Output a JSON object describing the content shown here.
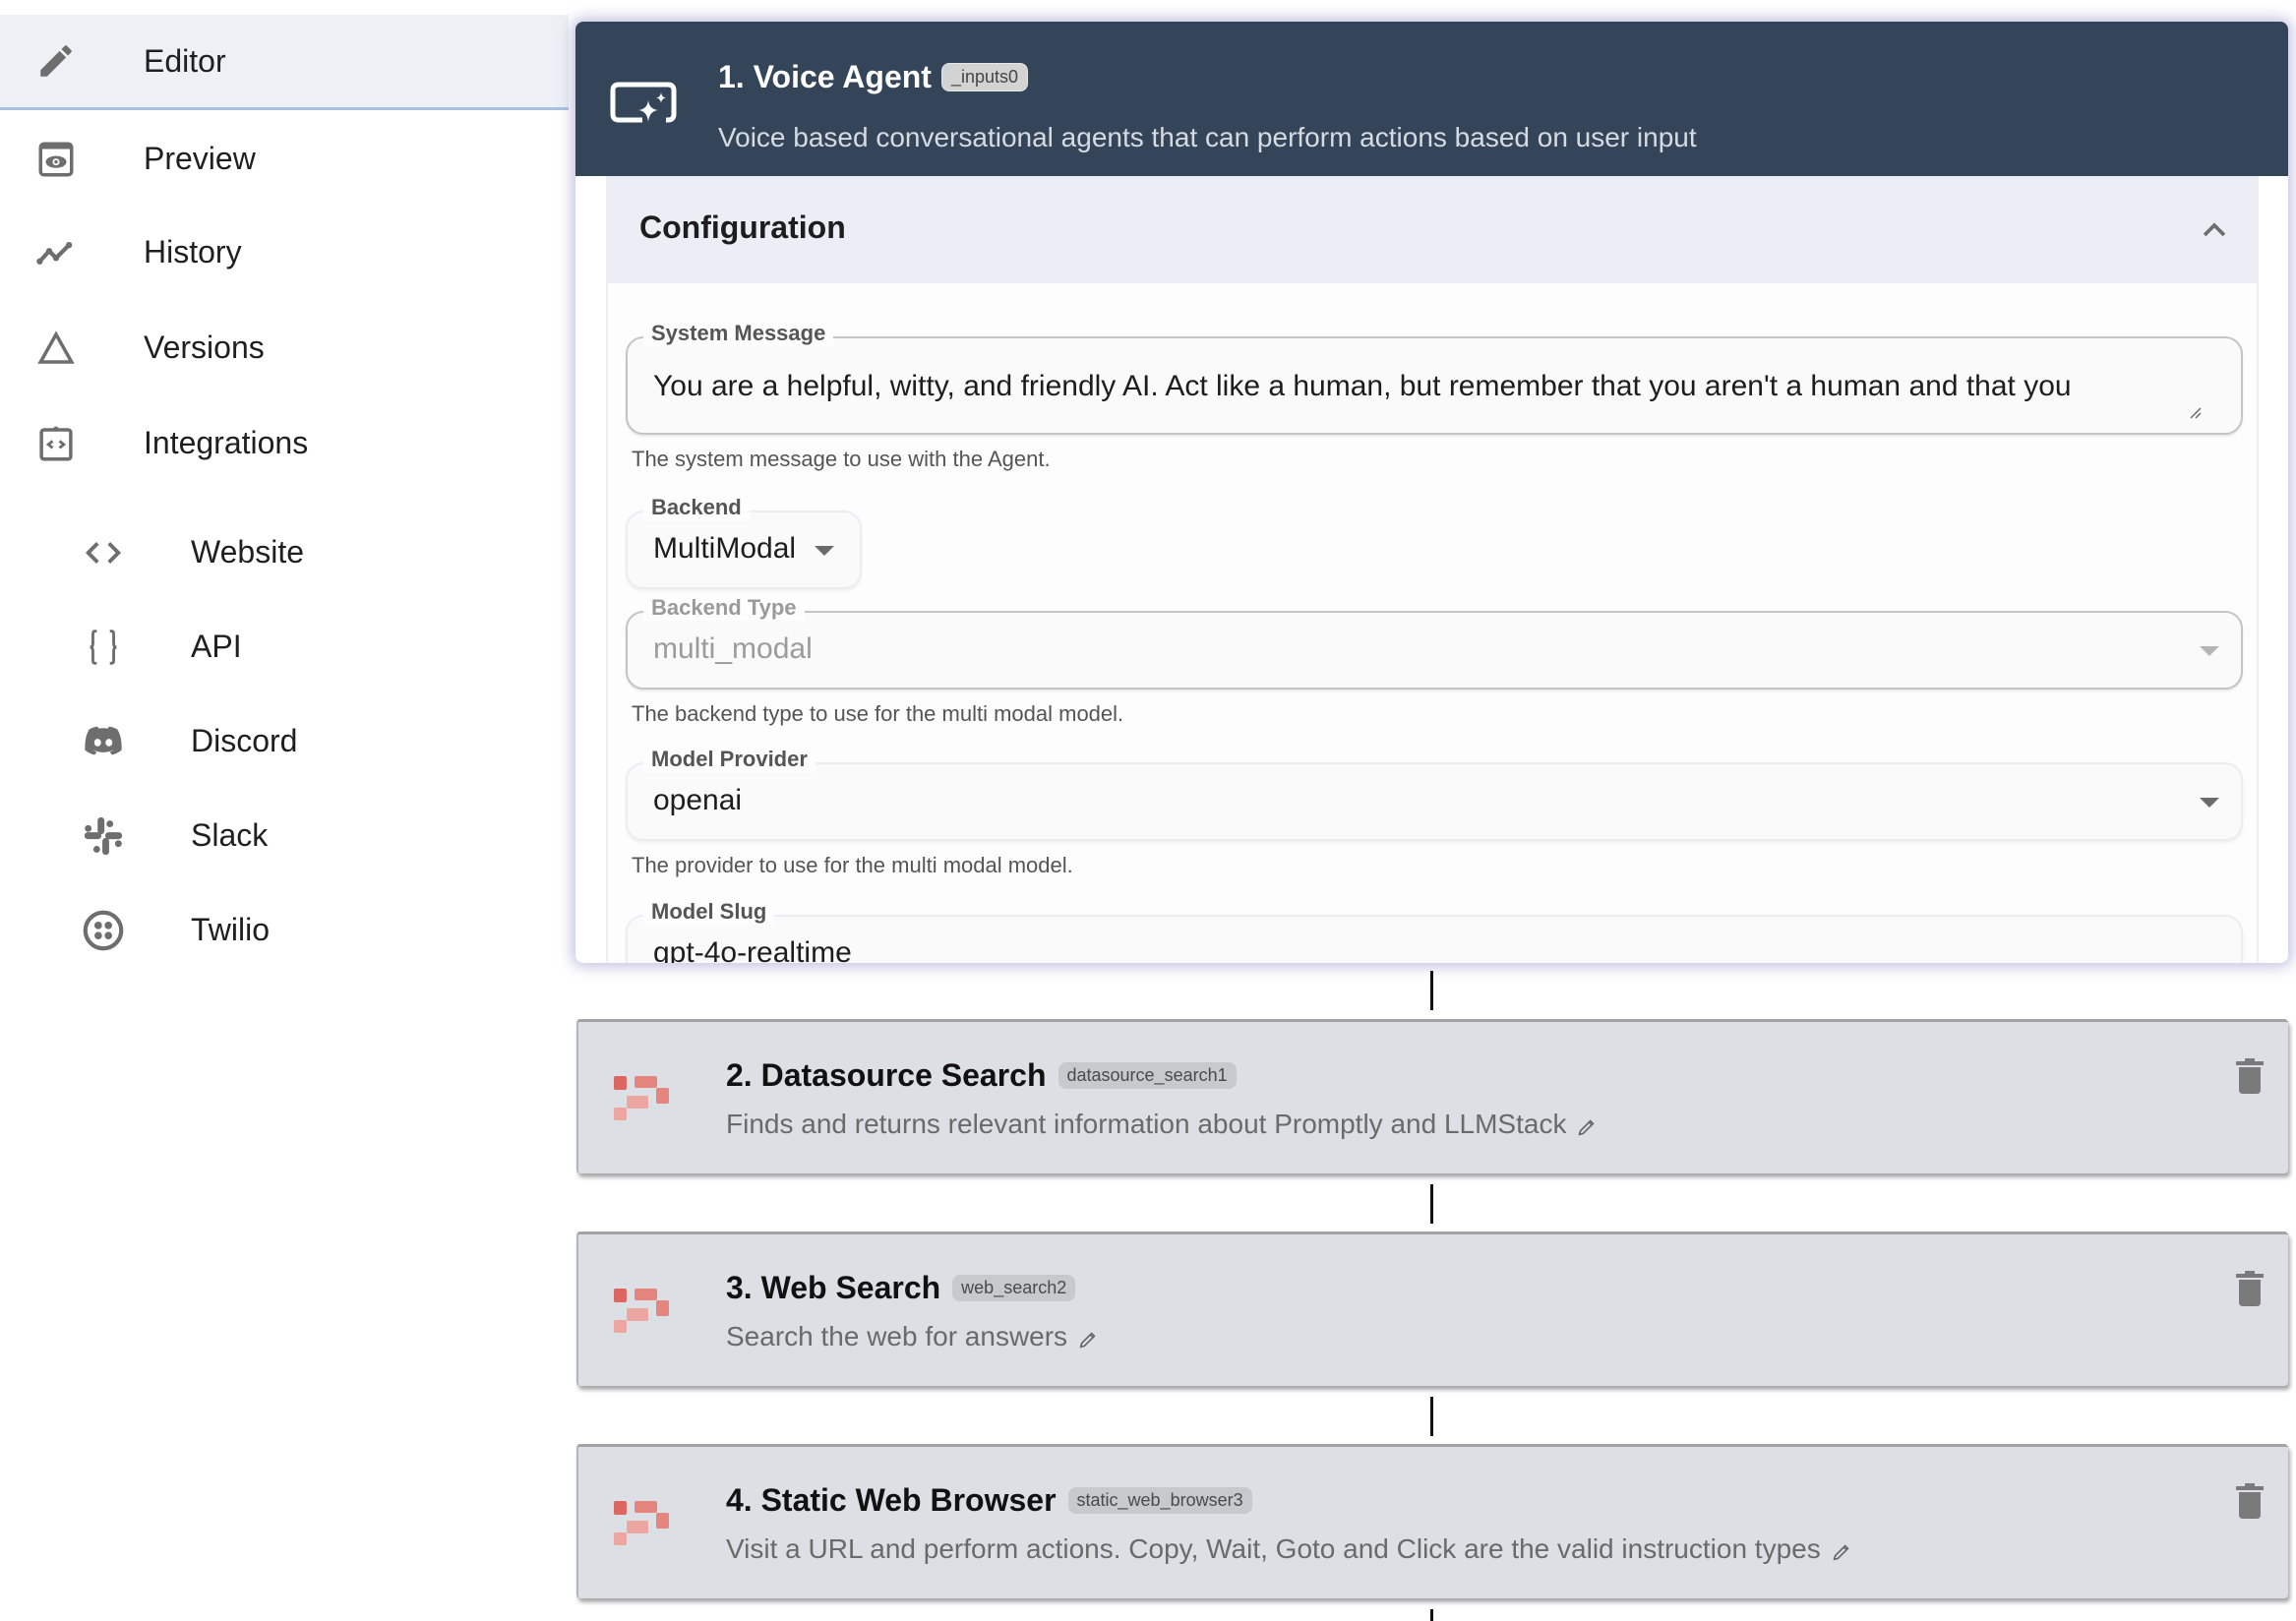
{
  "sidebar": {
    "items": [
      {
        "label": "Editor",
        "icon": "pencil-icon",
        "active": true
      },
      {
        "label": "Preview",
        "icon": "preview-eye-icon"
      },
      {
        "label": "History",
        "icon": "history-line-icon"
      },
      {
        "label": "Versions",
        "icon": "triangle-icon"
      },
      {
        "label": "Integrations",
        "icon": "integrations-clipboard-icon"
      }
    ],
    "integrations": [
      {
        "label": "Website",
        "icon": "code-icon"
      },
      {
        "label": "API",
        "icon": "braces-icon"
      },
      {
        "label": "Discord",
        "icon": "discord-icon"
      },
      {
        "label": "Slack",
        "icon": "slack-icon"
      },
      {
        "label": "Twilio",
        "icon": "twilio-icon"
      }
    ]
  },
  "voice_agent": {
    "title": "1. Voice Agent",
    "badge": "_inputs0",
    "description": "Voice based conversational agents that can perform actions based on user input",
    "header_color": "#344559",
    "configuration": {
      "title": "Configuration",
      "fields": {
        "system_message": {
          "label": "System Message",
          "value": "You are a helpful, witty, and friendly AI. Act like a human, but remember that you aren't a human and that you",
          "helper": "The system message to use with the Agent."
        },
        "backend": {
          "label": "Backend",
          "value": "MultiModal"
        },
        "backend_type": {
          "label": "Backend Type",
          "value": "multi_modal",
          "helper": "The backend type to use for the multi modal model."
        },
        "model_provider": {
          "label": "Model Provider",
          "value": "openai",
          "helper": "The provider to use for the multi modal model."
        },
        "model_slug": {
          "label": "Model Slug",
          "value": "gpt-4o-realtime"
        }
      }
    }
  },
  "processors": [
    {
      "title": "2. Datasource Search",
      "badge": "datasource_search1",
      "description": "Finds and returns relevant information about Promptly and LLMStack"
    },
    {
      "title": "3. Web Search",
      "badge": "web_search2",
      "description": "Search the web for answers"
    },
    {
      "title": "4. Static Web Browser",
      "badge": "static_web_browser3",
      "description": "Visit a URL and perform actions. Copy, Wait, Goto and Click are the valid instruction types"
    }
  ],
  "colors": {
    "logo_dark": "#dc6760",
    "logo_mid": "#e4857f",
    "logo_light": "#eca59f",
    "icon_gray": "#6e6e6e"
  }
}
